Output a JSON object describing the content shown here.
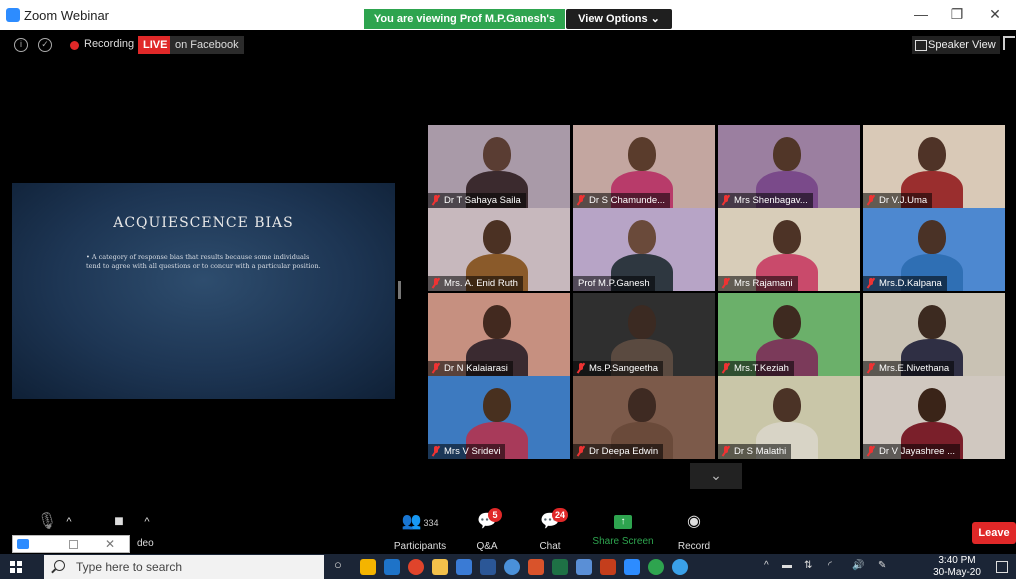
{
  "window": {
    "title": "Zoom Webinar",
    "banner": "You are viewing Prof M.P.Ganesh's screen",
    "view_options": "View Options ⌄",
    "minimize": "—",
    "restore": "❐",
    "close": "✕"
  },
  "meeting_bar": {
    "recording": "Recording",
    "live": "LIVE",
    "live_platform": "on Facebook",
    "speaker_view": "Speaker View"
  },
  "slide": {
    "title": "ACQUIESCENCE BIAS",
    "bullet": "• A category of response bias that results because some individuals tend to agree with all questions or to concur with a particular position."
  },
  "participants_grid": [
    {
      "name": "Dr T Sahaya Saila",
      "muted": true
    },
    {
      "name": "Dr S Chamunde...",
      "muted": true
    },
    {
      "name": "Mrs Shenbagav...",
      "muted": true
    },
    {
      "name": "Dr V.J.Uma",
      "muted": true
    },
    {
      "name": "Mrs. A. Enid Ruth",
      "muted": true
    },
    {
      "name": "Prof M.P.Ganesh",
      "muted": false,
      "active_speaker": true
    },
    {
      "name": "Mrs Rajamani",
      "muted": true
    },
    {
      "name": "Mrs.D.Kalpana",
      "muted": true
    },
    {
      "name": "Dr N Kalaiarasi",
      "muted": true
    },
    {
      "name": "Ms.P.Sangeetha",
      "muted": true
    },
    {
      "name": "Mrs.T.Keziah",
      "muted": true
    },
    {
      "name": "Mrs.E.Nivethana",
      "muted": true
    },
    {
      "name": "Mrs V Sridevi",
      "muted": true
    },
    {
      "name": "Dr Deepa Edwin",
      "muted": true
    },
    {
      "name": "Dr S Malathi",
      "muted": true
    },
    {
      "name": "Dr V Jayashree ...",
      "muted": true
    }
  ],
  "controls": {
    "mute_caret": "^",
    "video_caret": "^",
    "video_label": "deo",
    "participants_label": "Participants",
    "participants_count": "334",
    "qa_label": "Q&A",
    "qa_badge": "5",
    "chat_label": "Chat",
    "chat_badge": "24",
    "share_label": "Share Screen",
    "record_label": "Record",
    "leave_label": "Leave",
    "scroll_down": "⌄"
  },
  "mini_panel": {
    "close": "✕"
  },
  "taskbar": {
    "search_placeholder": "Type here to search",
    "time": "3:40 PM",
    "date": "30-May-20"
  },
  "colors": {
    "live_red": "#e02828",
    "banner_green": "#2ea44f",
    "active_speaker_outline": "#c9d94a",
    "zoom_blue": "#2d8cff"
  }
}
